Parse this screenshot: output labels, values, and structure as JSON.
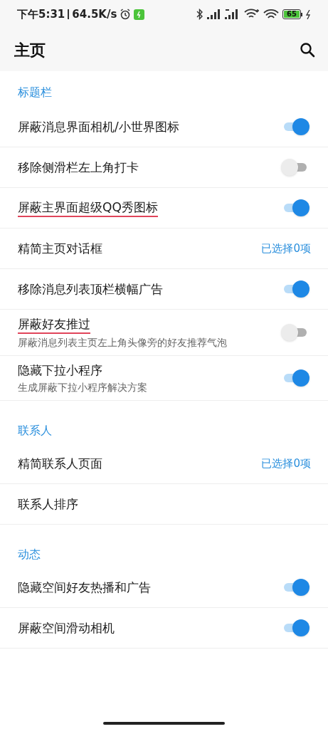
{
  "status_bar": {
    "time": "下午5:31",
    "speed": "64.5K/s",
    "battery": "65"
  },
  "app_bar": {
    "title": "主页"
  },
  "sections": [
    {
      "title": "标题栏",
      "items": [
        {
          "kind": "toggle",
          "title": "屏蔽消息界面相机/小世界图标",
          "on": true,
          "underlined": false
        },
        {
          "kind": "toggle",
          "title": "移除侧滑栏左上角打卡",
          "on": false,
          "underlined": false
        },
        {
          "kind": "toggle",
          "title": "屏蔽主界面超级QQ秀图标",
          "on": true,
          "underlined": true
        },
        {
          "kind": "select",
          "title": "精简主页对话框",
          "value": "已选择0项",
          "underlined": false
        },
        {
          "kind": "toggle",
          "title": "移除消息列表顶栏横幅广告",
          "on": true,
          "underlined": false
        },
        {
          "kind": "toggle",
          "title": "屏蔽好友推过",
          "subtitle": "屏蔽消息列表主页左上角头像旁的好友推荐气泡",
          "on": false,
          "underlined": true
        },
        {
          "kind": "toggle",
          "title": "隐藏下拉小程序",
          "subtitle": "生成屏蔽下拉小程序解决方案",
          "on": true,
          "underlined": false
        }
      ]
    },
    {
      "title": "联系人",
      "items": [
        {
          "kind": "select",
          "title": "精简联系人页面",
          "value": "已选择0项",
          "underlined": false
        },
        {
          "kind": "plain",
          "title": "联系人排序",
          "underlined": false
        }
      ]
    },
    {
      "title": "动态",
      "items": [
        {
          "kind": "toggle",
          "title": "隐藏空间好友热播和广告",
          "on": true,
          "underlined": false
        },
        {
          "kind": "toggle",
          "title": "屏蔽空间滑动相机",
          "on": true,
          "underlined": false
        }
      ]
    }
  ]
}
